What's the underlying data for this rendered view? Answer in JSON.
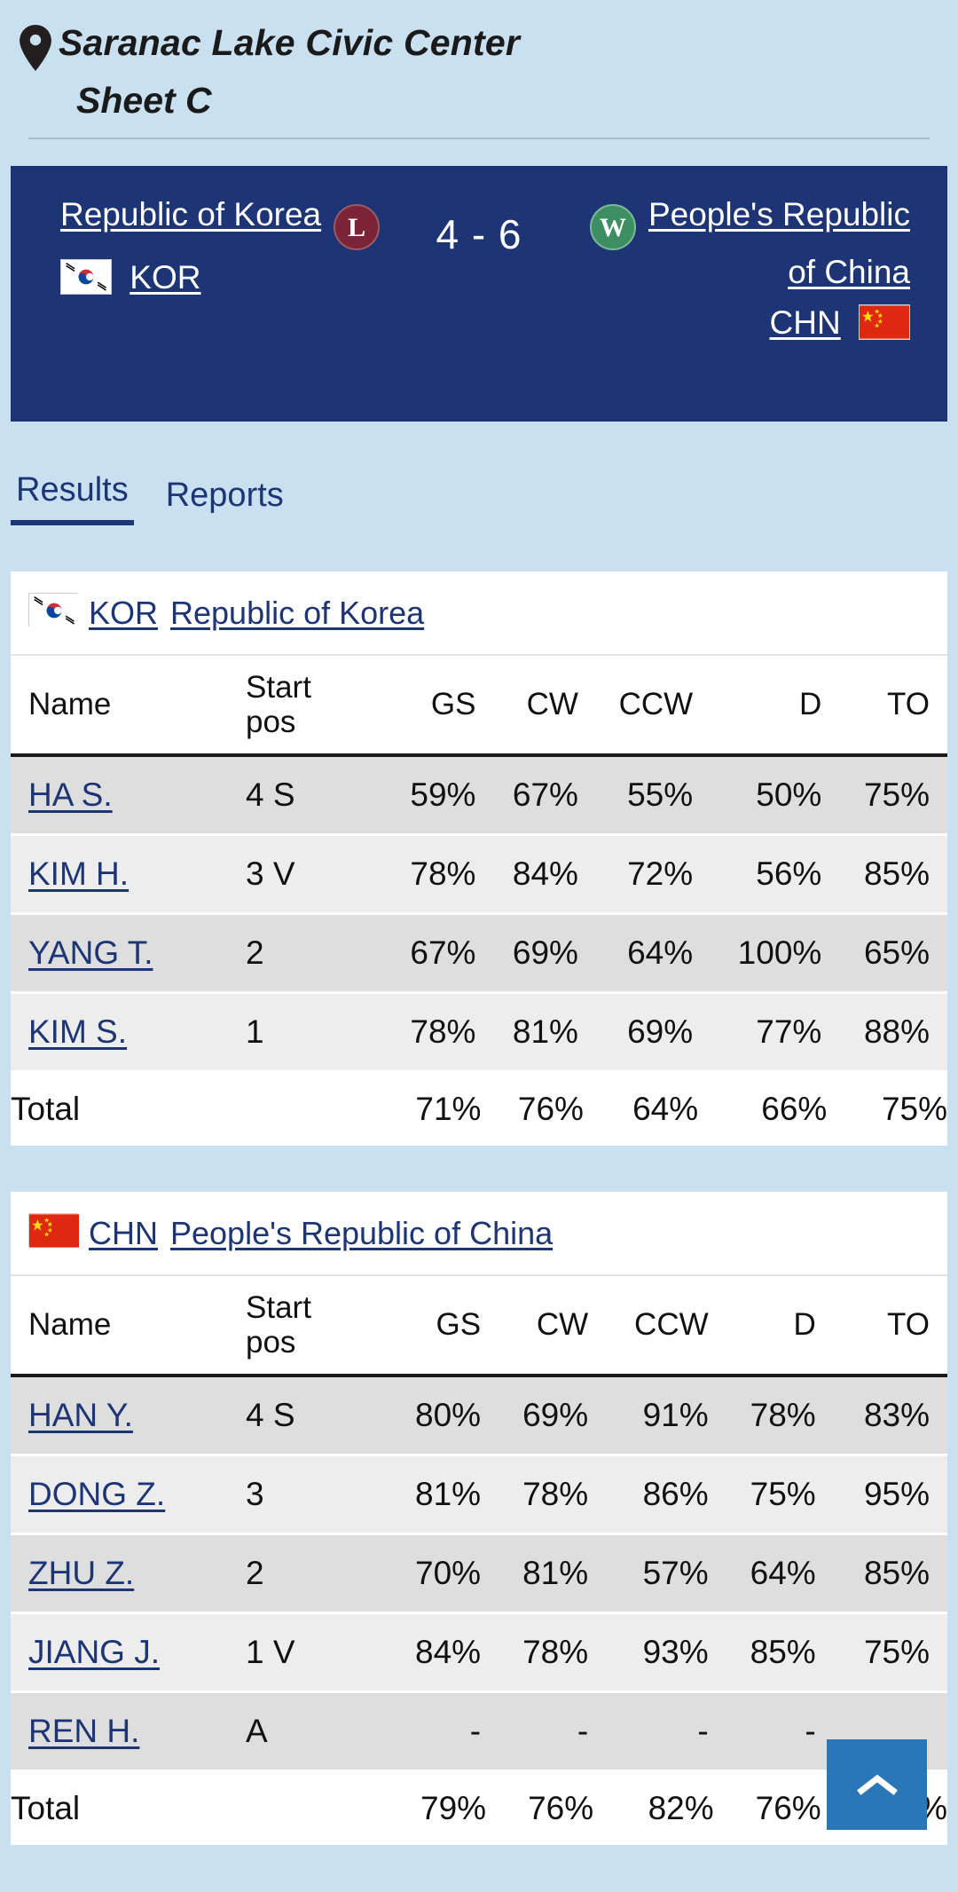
{
  "venue": {
    "name": "Saranac Lake Civic Center",
    "sheet": "Sheet C",
    "pin_icon": "map-pin-icon"
  },
  "scoreboard": {
    "home_team_name": "Republic of Korea",
    "home_team_code": "KOR",
    "home_result_badge": "L",
    "away_team_name": "People's Republic of China",
    "away_team_code": "CHN",
    "away_result_badge": "W",
    "score": "4 - 6",
    "home_score": 4,
    "away_score": 6,
    "navy": "#1e3575",
    "loss_color": "#7b2438",
    "win_color": "#3e8e63"
  },
  "tabs": [
    {
      "label": "Results",
      "active": true
    },
    {
      "label": "Reports",
      "active": false
    }
  ],
  "columns": [
    "Name",
    "Start pos",
    "GS",
    "CW",
    "CCW",
    "D",
    "TO"
  ],
  "start_pos_head_line1": "Start",
  "start_pos_head_line2": "pos",
  "teams": [
    {
      "code": "KOR",
      "name": "Republic of Korea",
      "flag": "flag-south-korea-icon",
      "players": [
        {
          "name": "HA S.",
          "start_pos": "4 S",
          "gs": "59%",
          "cw": "67%",
          "ccw": "55%",
          "d": "50%",
          "to": "75%"
        },
        {
          "name": "KIM H.",
          "start_pos": "3 V",
          "gs": "78%",
          "cw": "84%",
          "ccw": "72%",
          "d": "56%",
          "to": "85%"
        },
        {
          "name": "YANG T.",
          "start_pos": "2",
          "gs": "67%",
          "cw": "69%",
          "ccw": "64%",
          "d": "100%",
          "to": "65%"
        },
        {
          "name": "KIM S.",
          "start_pos": "1",
          "gs": "78%",
          "cw": "81%",
          "ccw": "69%",
          "d": "77%",
          "to": "88%"
        }
      ],
      "total": {
        "name": "Total",
        "start_pos": "",
        "gs": "71%",
        "cw": "76%",
        "ccw": "64%",
        "d": "66%",
        "to": "75%"
      }
    },
    {
      "code": "CHN",
      "name": "People's Republic of China",
      "flag": "flag-china-icon",
      "players": [
        {
          "name": "HAN Y.",
          "start_pos": "4 S",
          "gs": "80%",
          "cw": "69%",
          "ccw": "91%",
          "d": "78%",
          "to": "83%"
        },
        {
          "name": "DONG Z.",
          "start_pos": "3",
          "gs": "81%",
          "cw": "78%",
          "ccw": "86%",
          "d": "75%",
          "to": "95%"
        },
        {
          "name": "ZHU Z.",
          "start_pos": "2",
          "gs": "70%",
          "cw": "81%",
          "ccw": "57%",
          "d": "64%",
          "to": "85%"
        },
        {
          "name": "JIANG J.",
          "start_pos": "1 V",
          "gs": "84%",
          "cw": "78%",
          "ccw": "93%",
          "d": "85%",
          "to": "75%"
        },
        {
          "name": "REN H.",
          "start_pos": "A",
          "gs": "-",
          "cw": "-",
          "ccw": "-",
          "d": "-",
          "to": ""
        }
      ],
      "total": {
        "name": "Total",
        "start_pos": "",
        "gs": "79%",
        "cw": "76%",
        "ccw": "82%",
        "d": "76%",
        "to": "87%"
      }
    }
  ],
  "scroll_top_button": {
    "icon": "chevron-up-icon",
    "color": "#2a77b8"
  }
}
